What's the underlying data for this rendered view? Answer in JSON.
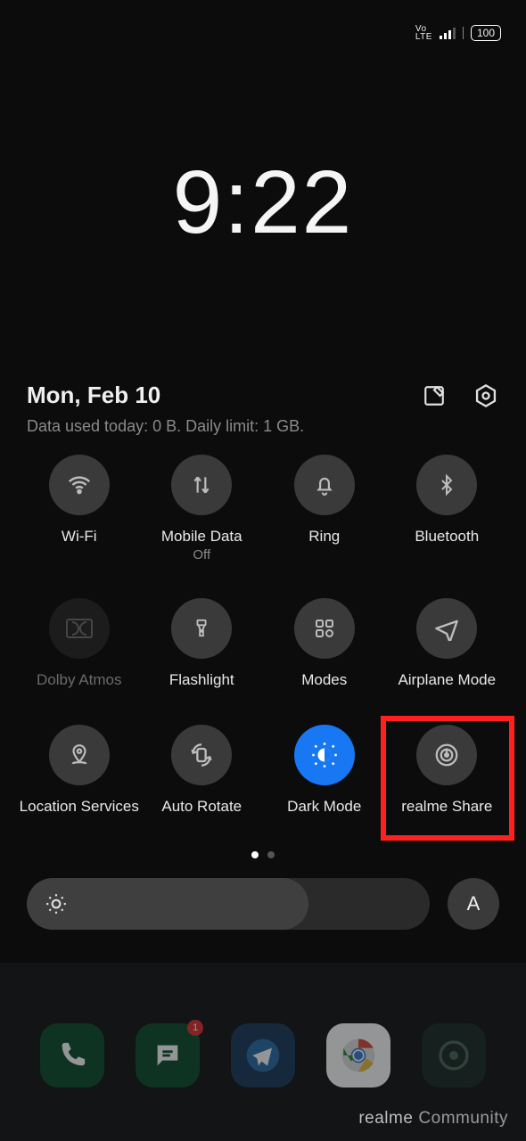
{
  "status": {
    "volte_top": "Vo",
    "volte_bot": "LTE",
    "battery": "100"
  },
  "clock": "9:22",
  "date": "Mon, Feb 10",
  "usage": "Data used today: 0 B. Daily limit: 1 GB.",
  "tiles": [
    {
      "label": "Wi-Fi",
      "sub": "",
      "icon": "wifi",
      "state": "off"
    },
    {
      "label": "Mobile Data",
      "sub": "Off",
      "icon": "data",
      "state": "off"
    },
    {
      "label": "Ring",
      "sub": "",
      "icon": "bell",
      "state": "off"
    },
    {
      "label": "Bluetooth",
      "sub": "",
      "icon": "bt",
      "state": "off"
    },
    {
      "label": "Dolby Atmos",
      "sub": "",
      "icon": "dolby",
      "state": "disabled"
    },
    {
      "label": "Flashlight",
      "sub": "",
      "icon": "flash",
      "state": "off"
    },
    {
      "label": "Modes",
      "sub": "",
      "icon": "modes",
      "state": "off"
    },
    {
      "label": "Airplane Mode",
      "sub": "",
      "icon": "plane",
      "state": "off"
    },
    {
      "label": "Location Services",
      "sub": "",
      "icon": "loc",
      "state": "off"
    },
    {
      "label": "Auto Rotate",
      "sub": "",
      "icon": "rotate",
      "state": "off"
    },
    {
      "label": "Dark Mode",
      "sub": "",
      "icon": "dark",
      "state": "on"
    },
    {
      "label": "realme Share",
      "sub": "",
      "icon": "share",
      "state": "off",
      "highlighted": true
    }
  ],
  "auto_brightness_label": "A",
  "messages_badge": "1",
  "watermark_brand": "realme",
  "watermark_text": "Community"
}
